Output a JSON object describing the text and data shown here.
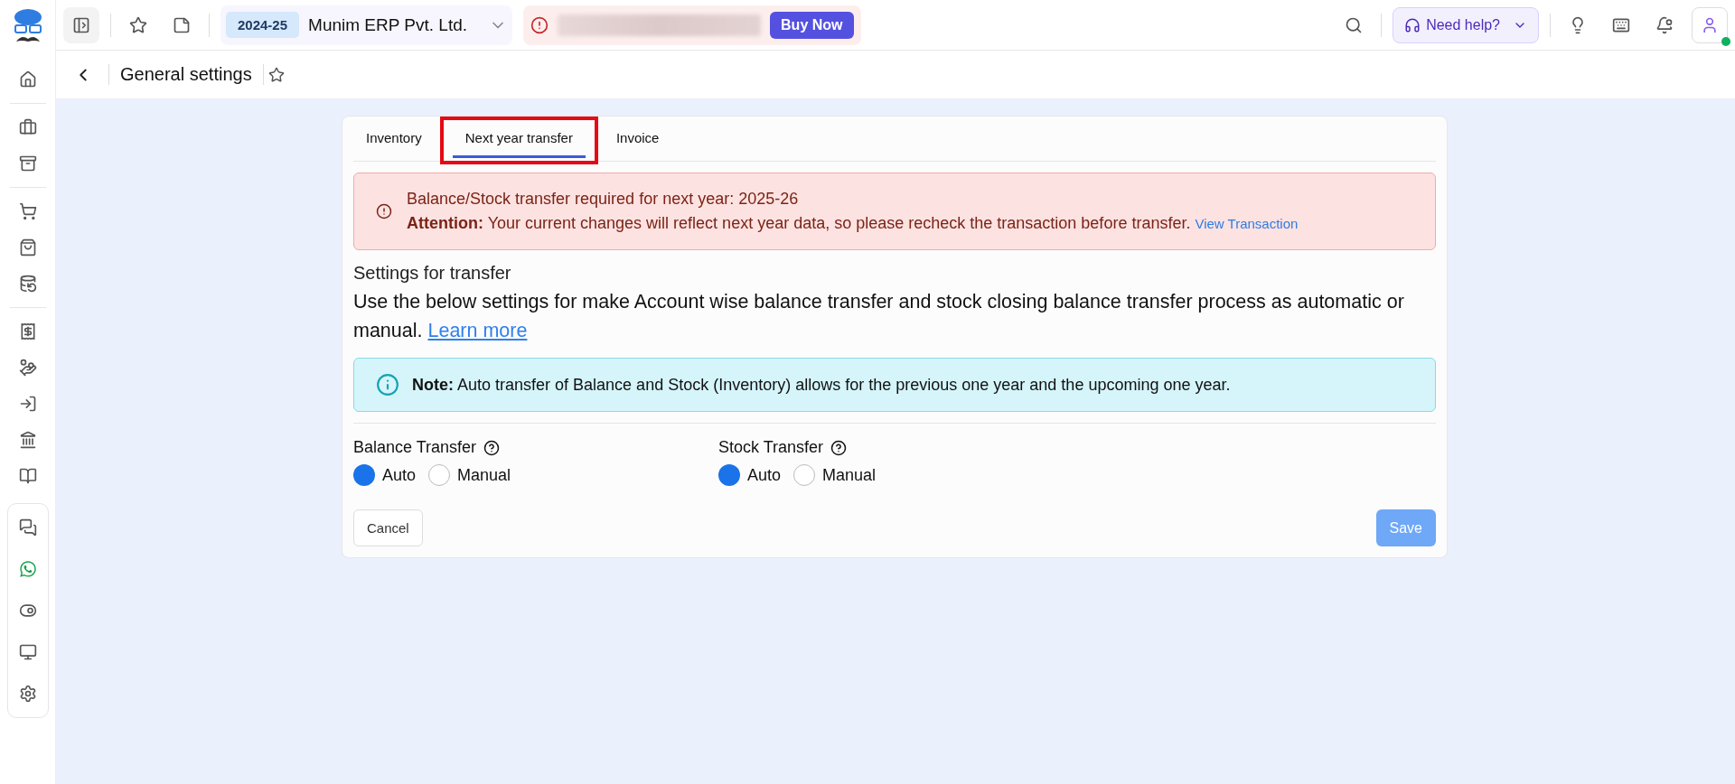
{
  "topbar": {
    "financial_year": "2024-25",
    "company": "Munim ERP Pvt. Ltd.",
    "buy_button": "Buy Now",
    "help_button": "Need help?",
    "user_online": true
  },
  "page": {
    "title": "General settings"
  },
  "tabs": [
    {
      "label": "Inventory",
      "selected": false,
      "highlighted": false
    },
    {
      "label": "Next year transfer",
      "selected": true,
      "highlighted": true
    },
    {
      "label": "Invoice",
      "selected": false,
      "highlighted": false
    }
  ],
  "alert": {
    "title": "Balance/Stock transfer required for next year: 2025-26",
    "message": "**Attention:** Your current changes will reflect next year data, so please recheck the transaction before transfer.",
    "link": "View Transaction"
  },
  "section": {
    "heading": "Settings for transfer",
    "description": "Use the below settings for make Account wise balance transfer and stock closing balance transfer process as automatic or manual.",
    "link": "Learn more"
  },
  "note": "**Note:** Auto transfer of Balance and Stock (Inventory) allows for the previous one year and the upcoming one year.",
  "transfer_groups": [
    {
      "label": "Balance Transfer",
      "options": [
        {
          "label": "Auto",
          "selected": true
        },
        {
          "label": "Manual",
          "selected": false
        }
      ]
    },
    {
      "label": "Stock Transfer",
      "options": [
        {
          "label": "Auto",
          "selected": true
        },
        {
          "label": "Manual",
          "selected": false
        }
      ]
    }
  ],
  "actions": {
    "cancel": "Cancel",
    "save": "Save",
    "save_disabled": true
  }
}
